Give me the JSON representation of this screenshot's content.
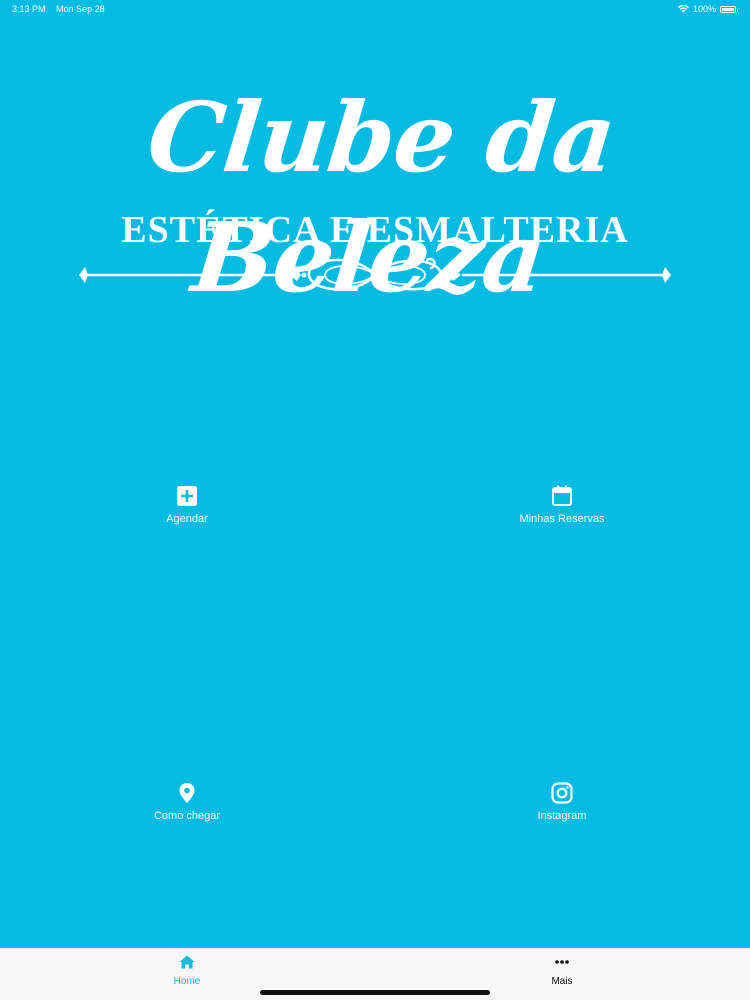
{
  "status_bar": {
    "time": "3:13 PM",
    "date": "Mon Sep 28",
    "battery": "100%"
  },
  "logo": {
    "title": "Clube da Beleza",
    "subtitle": "ESTÉTICA E ESMALTERIA"
  },
  "tiles": [
    {
      "label": "Agendar",
      "icon": "plus-square-icon"
    },
    {
      "label": "Minhas Reservas",
      "icon": "calendar-icon"
    },
    {
      "label": "Como chegar",
      "icon": "map-pin-icon"
    },
    {
      "label": "Instagram",
      "icon": "instagram-icon"
    }
  ],
  "tab_bar": {
    "items": [
      {
        "label": "Home",
        "icon": "home-icon",
        "active": true
      },
      {
        "label": "Mais",
        "icon": "more-dots-icon",
        "active": false
      }
    ]
  },
  "colors": {
    "background": "#03BBE3",
    "active_tab": "#1CB8DD",
    "tab_bar": "#F7F7F7"
  }
}
